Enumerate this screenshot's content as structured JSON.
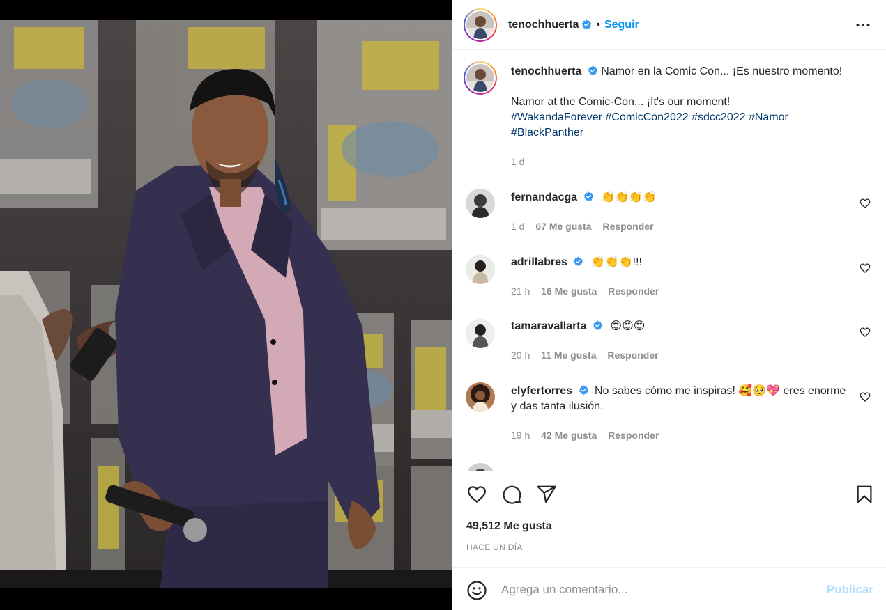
{
  "post": {
    "username": "tenochhuerta",
    "follow_label": "Seguir",
    "separator": "•",
    "caption_line1": "Namor en la Comic Con... ¡Es nuestro momento!",
    "caption_line2": "Namor at the Comic-Con... ¡It's our moment!",
    "hashtags": [
      "#WakandaForever",
      "#ComicCon2022",
      "#sdcc2022",
      "#Namor",
      "#BlackPanther"
    ],
    "caption_age": "1 d",
    "likes": "49,512 Me gusta",
    "time_ago": "HACE UN DÍA"
  },
  "comments": [
    {
      "username": "fernandacga",
      "text": "👏👏👏👏",
      "age": "1 d",
      "likes": "67 Me gusta",
      "reply": "Responder"
    },
    {
      "username": "adrillabres",
      "text": "👏👏👏!!!",
      "age": "21 h",
      "likes": "16 Me gusta",
      "reply": "Responder"
    },
    {
      "username": "tamaravallarta",
      "text": "😍😍😍",
      "age": "20 h",
      "likes": "11 Me gusta",
      "reply": "Responder"
    },
    {
      "username": "elyfertorres",
      "text": "No sabes cómo me inspiras! 🥰🥺💖 eres enorme y das tanta ilusión.",
      "age": "19 h",
      "likes": "42 Me gusta",
      "reply": "Responder"
    }
  ],
  "composer": {
    "placeholder": "Agrega un comentario...",
    "publish_label": "Publicar"
  },
  "colors": {
    "accent": "#0095f6",
    "hashtag": "#00376b",
    "muted": "#8e8e8e",
    "verified": "#3897f0",
    "publish_disabled": "#b2dffc"
  },
  "icons": [
    "more-options-icon",
    "verified-badge-icon",
    "like-heart-icon",
    "comment-icon",
    "share-icon",
    "save-bookmark-icon",
    "emoji-icon"
  ]
}
